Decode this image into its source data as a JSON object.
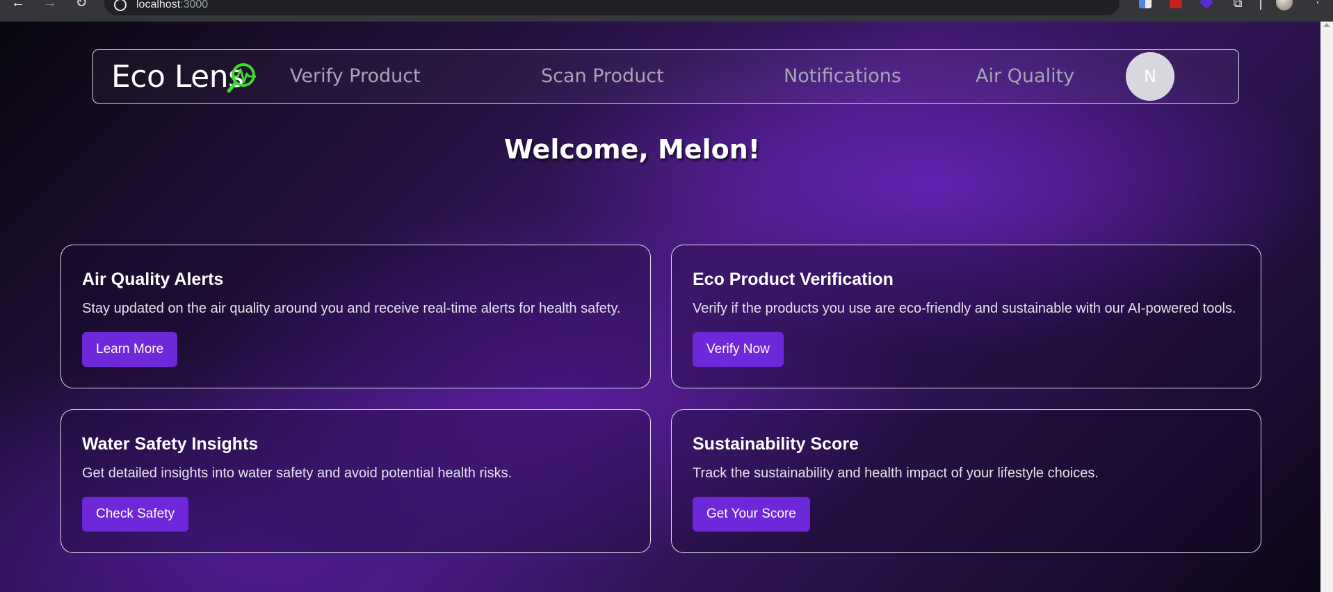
{
  "browser": {
    "url_host": "localhost",
    "url_port": ":3000"
  },
  "navbar": {
    "logo_text": "Eco Lens",
    "links": [
      {
        "label": "Verify Product"
      },
      {
        "label": "Scan Product"
      },
      {
        "label": "Notifications"
      },
      {
        "label": "Air Quality"
      }
    ],
    "avatar_initial": "N"
  },
  "welcome": "Welcome, Melon!",
  "cards": [
    {
      "title": "Air Quality Alerts",
      "description": "Stay updated on the air quality around you and receive real-time alerts for health safety.",
      "button": "Learn More"
    },
    {
      "title": "Eco Product Verification",
      "description": "Verify if the products you use are eco-friendly and sustainable with our AI-powered tools.",
      "button": "Verify Now"
    },
    {
      "title": "Water Safety Insights",
      "description": "Get detailed insights into water safety and avoid potential health risks.",
      "button": "Check Safety"
    },
    {
      "title": "Sustainability Score",
      "description": "Track the sustainability and health impact of your lifestyle choices.",
      "button": "Get Your Score"
    }
  ],
  "colors": {
    "accent": "#6d28d9",
    "logo_icon": "#3ddc2f"
  }
}
